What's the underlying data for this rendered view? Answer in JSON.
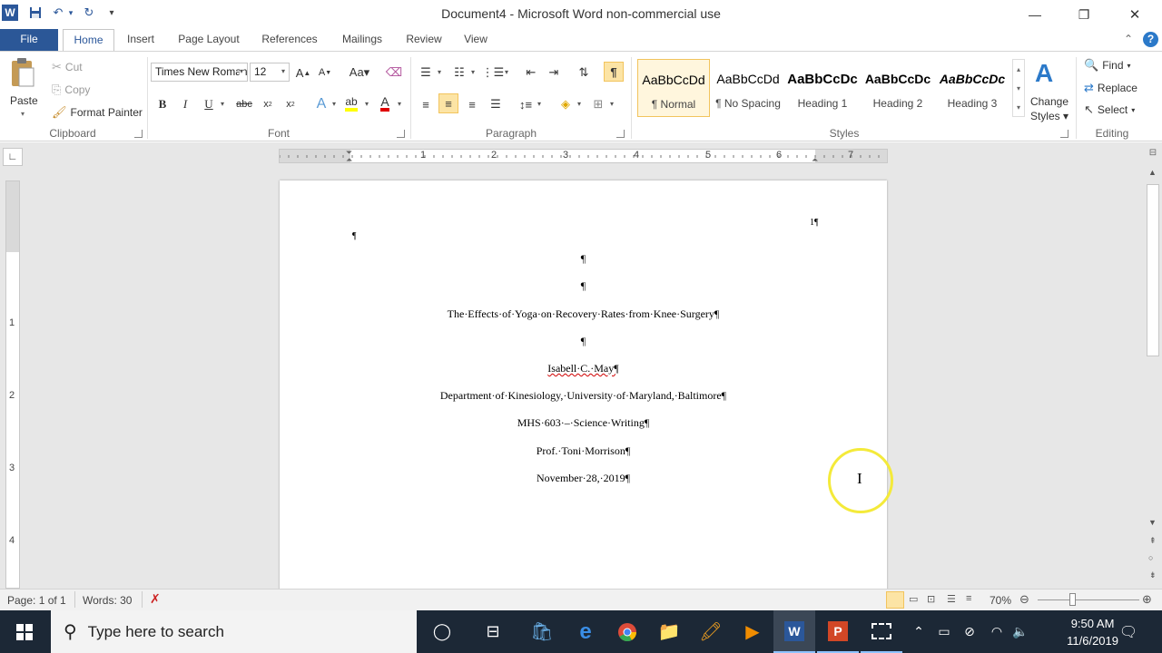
{
  "window": {
    "title": "Document4 - Microsoft Word non-commercial use",
    "minimize": "—",
    "restore": "❐",
    "close": "✕"
  },
  "qat": {
    "save": "💾",
    "undo": "↶",
    "redo": "↻",
    "customize": "▾"
  },
  "tabs": [
    {
      "label": "File"
    },
    {
      "label": "Home"
    },
    {
      "label": "Insert"
    },
    {
      "label": "Page Layout"
    },
    {
      "label": "References"
    },
    {
      "label": "Mailings"
    },
    {
      "label": "Review"
    },
    {
      "label": "View"
    }
  ],
  "ribbon_right": {
    "collapse": "⌃",
    "help": "?"
  },
  "clipboard": {
    "paste": "Paste",
    "cut": "Cut",
    "copy": "Copy",
    "format_painter": "Format Painter",
    "label": "Clipboard"
  },
  "font": {
    "name": "Times New Roman",
    "size": "12",
    "label": "Font"
  },
  "paragraph": {
    "label": "Paragraph"
  },
  "styles": {
    "items": [
      {
        "sample": "AaBbCcDd",
        "name": "¶ Normal"
      },
      {
        "sample": "AaBbCcDd",
        "name": "¶ No Spacing"
      },
      {
        "sample": "AaBbCcDc",
        "name": "Heading 1"
      },
      {
        "sample": "AaBbCcDc",
        "name": "Heading 2"
      },
      {
        "sample": "AaBbCcDc",
        "name": "Heading 3"
      }
    ],
    "change_styles": "Change Styles",
    "label": "Styles"
  },
  "editing": {
    "find": "Find",
    "replace": "Replace",
    "select": "Select",
    "label": "Editing"
  },
  "ruler": {
    "numbers": [
      "1",
      "2",
      "3",
      "4",
      "5",
      "6",
      "7"
    ],
    "vnumbers": [
      "1",
      "2",
      "3",
      "4"
    ]
  },
  "document": {
    "page_number": "1¶",
    "left_mark": "¶",
    "lines": [
      "¶",
      "¶",
      "The·Effects·of·Yoga·on·Recovery·Rates·from·Knee·Surgery¶",
      "¶",
      "Isabell·C.·May¶",
      "Department·of·Kinesiology,·University·of·Maryland,·Baltimore¶",
      "MHS·603·–·Science·Writing¶",
      "Prof.·Toni·Morrison¶",
      "November·28,·2019¶"
    ]
  },
  "status": {
    "page": "Page: 1 of 1",
    "words": "Words: 30",
    "zoom": "70%"
  },
  "taskbar": {
    "search_placeholder": "Type here to search",
    "time": "9:50 AM",
    "date": "11/6/2019"
  }
}
